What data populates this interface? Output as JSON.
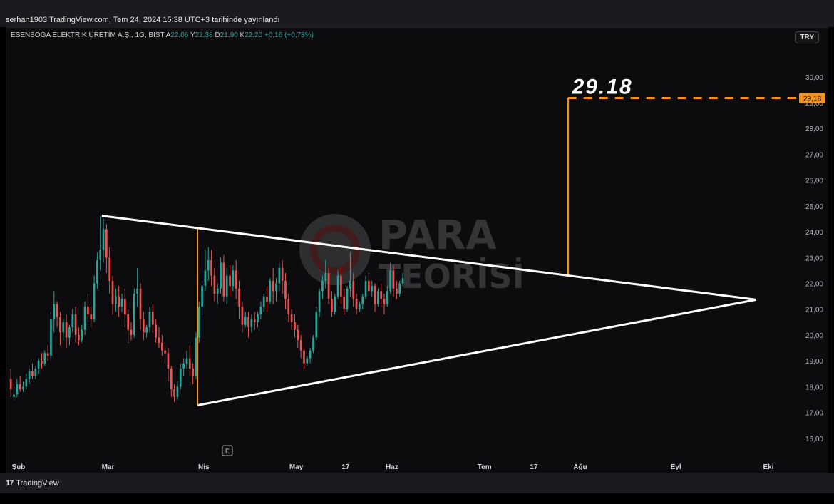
{
  "header": {
    "published_text": "serhan1903 TradingView.com, Tem 24, 2024 15:38 UTC+3 tarihinde yayınlandı"
  },
  "legend": {
    "symbol": "ESENBOĞA ELEKTRİK ÜRETİM A.Ş., 1G, BIST",
    "o_label": "A",
    "o_value": "22,06",
    "h_label": "Y",
    "h_value": "22,38",
    "l_label": "D",
    "l_value": "21,90",
    "c_label": "K",
    "c_value": "22,20",
    "change": "+0,16 (+0,73%)"
  },
  "currency": "TRY",
  "footer": {
    "brand": "TradingView",
    "logo_glyph": "17"
  },
  "earnings_marker": "E",
  "watermark": {
    "line1": "PARA",
    "line2": "TEORİSİ"
  },
  "colors": {
    "up": "#26a69a",
    "down": "#ef5350",
    "accent": "#f7931a",
    "line": "#ffffff",
    "axis_text": "#b2b5be"
  },
  "chart_data": {
    "type": "candlestick",
    "x_ticks": [
      {
        "label": "Şub",
        "day": 3
      },
      {
        "label": "Mar",
        "day": 32
      },
      {
        "label": "Nis",
        "day": 63
      },
      {
        "label": "May",
        "day": 93
      },
      {
        "label": "17",
        "day": 109
      },
      {
        "label": "Haz",
        "day": 124
      },
      {
        "label": "Tem",
        "day": 154
      },
      {
        "label": "17",
        "day": 170
      },
      {
        "label": "Ağu",
        "day": 185
      },
      {
        "label": "Eyl",
        "day": 216
      },
      {
        "label": "Eki",
        "day": 246
      }
    ],
    "y_ticks": [
      "16,00",
      "17,00",
      "18,00",
      "19,00",
      "20,00",
      "21,00",
      "22,00",
      "23,00",
      "24,00",
      "25,00",
      "26,00",
      "27,00",
      "28,00",
      "29,00",
      "30,00"
    ],
    "ylim": [
      15.25,
      30.85
    ],
    "xlim": [
      0,
      255
    ],
    "candles": [
      [
        18.3,
        18.7,
        17.9,
        17.6
      ],
      [
        17.6,
        18.0,
        17.7,
        17.5
      ],
      [
        17.7,
        18.3,
        18.1,
        17.6
      ],
      [
        18.1,
        18.4,
        17.9,
        17.8
      ],
      [
        17.9,
        18.2,
        18.0,
        17.8
      ],
      [
        18.0,
        18.5,
        18.3,
        17.9
      ],
      [
        18.3,
        18.7,
        18.6,
        18.1
      ],
      [
        18.6,
        18.9,
        18.4,
        18.3
      ],
      [
        18.4,
        18.8,
        18.7,
        18.3
      ],
      [
        18.7,
        19.1,
        19.0,
        18.5
      ],
      [
        19.0,
        19.3,
        18.9,
        18.7
      ],
      [
        18.9,
        19.4,
        19.3,
        18.8
      ],
      [
        19.3,
        19.6,
        19.2,
        19.0
      ],
      [
        19.2,
        20.9,
        20.6,
        19.1
      ],
      [
        20.6,
        21.7,
        21.2,
        20.1
      ],
      [
        21.2,
        21.3,
        20.7,
        20.3
      ],
      [
        20.7,
        20.9,
        20.1,
        19.6
      ],
      [
        20.1,
        20.6,
        20.5,
        19.8
      ],
      [
        20.5,
        20.8,
        19.9,
        19.5
      ],
      [
        19.9,
        20.4,
        20.3,
        19.6
      ],
      [
        20.3,
        21.0,
        20.8,
        20.1
      ],
      [
        20.8,
        21.1,
        20.0,
        19.7
      ],
      [
        20.0,
        20.3,
        19.8,
        19.6
      ],
      [
        19.8,
        20.4,
        20.2,
        19.7
      ],
      [
        20.2,
        21.3,
        21.1,
        20.0
      ],
      [
        21.1,
        21.6,
        20.8,
        20.5
      ],
      [
        20.8,
        21.1,
        20.6,
        20.3
      ],
      [
        20.6,
        22.3,
        22.0,
        20.5
      ],
      [
        22.0,
        23.2,
        22.9,
        21.8
      ],
      [
        22.9,
        24.6,
        23.3,
        22.5
      ],
      [
        23.3,
        24.5,
        24.1,
        22.8
      ],
      [
        24.1,
        24.3,
        23.0,
        22.4
      ],
      [
        23.0,
        23.4,
        22.1,
        21.6
      ],
      [
        22.1,
        22.3,
        21.2,
        20.8
      ],
      [
        21.2,
        21.8,
        21.5,
        20.9
      ],
      [
        21.5,
        21.9,
        21.1,
        20.7
      ],
      [
        21.1,
        21.6,
        21.4,
        20.9
      ],
      [
        21.4,
        21.8,
        20.8,
        20.3
      ],
      [
        20.8,
        21.0,
        20.2,
        19.7
      ],
      [
        20.2,
        20.5,
        20.0,
        19.8
      ],
      [
        20.0,
        21.8,
        21.6,
        19.9
      ],
      [
        21.6,
        22.6,
        21.8,
        21.1
      ],
      [
        21.8,
        22.0,
        20.6,
        20.2
      ],
      [
        20.6,
        20.9,
        20.1,
        19.8
      ],
      [
        20.1,
        20.4,
        20.3,
        19.9
      ],
      [
        20.3,
        21.1,
        20.9,
        20.1
      ],
      [
        20.9,
        21.2,
        20.4,
        20.1
      ],
      [
        20.4,
        20.6,
        19.9,
        19.7
      ],
      [
        19.9,
        20.3,
        19.7,
        19.5
      ],
      [
        19.7,
        20.0,
        19.4,
        19.2
      ],
      [
        19.4,
        19.6,
        19.3,
        18.9
      ],
      [
        19.3,
        19.5,
        18.7,
        18.2
      ],
      [
        18.7,
        18.8,
        17.9,
        17.6
      ],
      [
        17.9,
        18.1,
        17.6,
        17.4
      ],
      [
        17.6,
        18.2,
        18.0,
        17.5
      ],
      [
        18.0,
        18.9,
        18.7,
        17.9
      ],
      [
        18.7,
        19.1,
        18.9,
        18.4
      ],
      [
        18.9,
        19.4,
        19.1,
        18.7
      ],
      [
        19.1,
        19.6,
        18.7,
        18.4
      ],
      [
        18.7,
        18.9,
        18.4,
        18.1
      ],
      [
        18.4,
        20.1,
        19.9,
        18.3
      ],
      [
        19.9,
        21.3,
        21.1,
        19.7
      ],
      [
        21.1,
        22.1,
        21.9,
        20.8
      ],
      [
        21.9,
        23.3,
        22.5,
        21.7
      ],
      [
        22.5,
        23.4,
        22.9,
        22.1
      ],
      [
        22.9,
        23.3,
        22.3,
        21.9
      ],
      [
        22.3,
        22.6,
        21.6,
        21.3
      ],
      [
        21.6,
        22.0,
        21.8,
        21.2
      ],
      [
        21.8,
        23.0,
        22.8,
        21.6
      ],
      [
        22.8,
        23.1,
        21.5,
        21.3
      ],
      [
        21.5,
        22.6,
        22.3,
        21.2
      ],
      [
        22.3,
        22.7,
        21.9,
        21.5
      ],
      [
        21.9,
        22.7,
        22.5,
        21.7
      ],
      [
        22.5,
        22.9,
        21.8,
        21.4
      ],
      [
        21.8,
        22.1,
        21.1,
        20.6
      ],
      [
        21.1,
        21.3,
        20.4,
        20.1
      ],
      [
        20.4,
        20.9,
        20.7,
        20.3
      ],
      [
        20.7,
        20.9,
        20.3,
        19.9
      ],
      [
        20.3,
        20.8,
        20.6,
        20.1
      ],
      [
        20.6,
        20.9,
        20.5,
        20.2
      ],
      [
        20.5,
        20.9,
        20.8,
        20.3
      ],
      [
        20.8,
        21.3,
        21.1,
        20.6
      ],
      [
        21.1,
        21.6,
        21.5,
        20.9
      ],
      [
        21.5,
        21.9,
        21.3,
        20.9
      ],
      [
        21.3,
        22.2,
        22.1,
        21.2
      ],
      [
        22.1,
        22.6,
        21.7,
        21.2
      ],
      [
        21.7,
        22.2,
        22.0,
        21.3
      ],
      [
        22.0,
        22.8,
        22.6,
        21.7
      ],
      [
        22.6,
        22.9,
        22.1,
        21.6
      ],
      [
        22.1,
        22.4,
        21.4,
        21.0
      ],
      [
        21.4,
        21.6,
        20.8,
        20.5
      ],
      [
        20.8,
        21.0,
        20.5,
        20.2
      ],
      [
        20.5,
        20.8,
        20.2,
        19.9
      ],
      [
        20.2,
        20.4,
        19.8,
        19.5
      ],
      [
        19.8,
        20.0,
        19.4,
        19.1
      ],
      [
        19.4,
        19.5,
        18.9,
        18.7
      ],
      [
        18.9,
        19.2,
        19.1,
        18.8
      ],
      [
        19.1,
        19.5,
        19.4,
        18.9
      ],
      [
        19.4,
        20.0,
        19.9,
        19.3
      ],
      [
        19.9,
        21.1,
        20.9,
        19.8
      ],
      [
        20.9,
        21.8,
        21.7,
        20.7
      ],
      [
        21.7,
        22.3,
        22.1,
        21.4
      ],
      [
        22.1,
        22.9,
        22.4,
        21.8
      ],
      [
        22.4,
        22.6,
        21.4,
        21.2
      ],
      [
        21.4,
        21.7,
        20.9,
        20.7
      ],
      [
        20.9,
        21.6,
        21.5,
        20.8
      ],
      [
        21.5,
        22.5,
        22.3,
        21.4
      ],
      [
        22.3,
        22.6,
        21.5,
        21.2
      ],
      [
        21.5,
        21.8,
        21.0,
        20.8
      ],
      [
        21.0,
        21.9,
        21.8,
        20.9
      ],
      [
        21.8,
        23.2,
        22.1,
        21.5
      ],
      [
        22.1,
        22.4,
        21.4,
        21.1
      ],
      [
        21.4,
        21.6,
        21.0,
        20.8
      ],
      [
        21.0,
        21.3,
        21.2,
        20.9
      ],
      [
        21.2,
        21.6,
        21.5,
        21.0
      ],
      [
        21.5,
        22.3,
        22.1,
        21.4
      ],
      [
        22.1,
        22.4,
        21.7,
        21.5
      ],
      [
        21.7,
        22.1,
        21.9,
        21.5
      ],
      [
        21.9,
        22.0,
        21.2,
        20.9
      ],
      [
        21.2,
        21.8,
        21.7,
        21.1
      ],
      [
        21.7,
        22.0,
        21.4,
        21.1
      ],
      [
        21.4,
        21.6,
        21.2,
        20.8
      ],
      [
        21.2,
        21.9,
        21.7,
        21.1
      ],
      [
        21.7,
        22.8,
        22.5,
        21.6
      ],
      [
        22.5,
        22.7,
        21.8,
        21.5
      ],
      [
        21.8,
        22.1,
        21.6,
        21.4
      ],
      [
        21.6,
        22.1,
        22.0,
        21.5
      ],
      [
        22.0,
        22.4,
        22.2,
        21.9
      ]
    ],
    "annotations": {
      "triangle_upper": {
        "from": [
          30,
          24.62
        ],
        "to": [
          242,
          21.37
        ]
      },
      "triangle_lower": {
        "from": [
          61,
          17.28
        ],
        "to": [
          242,
          21.37
        ]
      },
      "measure_left": {
        "day": 61,
        "low": 17.28,
        "high": 24.1
      },
      "breakout": {
        "day": 181,
        "from": 22.35,
        "to": 29.18
      },
      "target_line": {
        "value": 29.18,
        "from_day": 181
      },
      "target_text": "29.18",
      "target_price_label": "29,18"
    }
  }
}
